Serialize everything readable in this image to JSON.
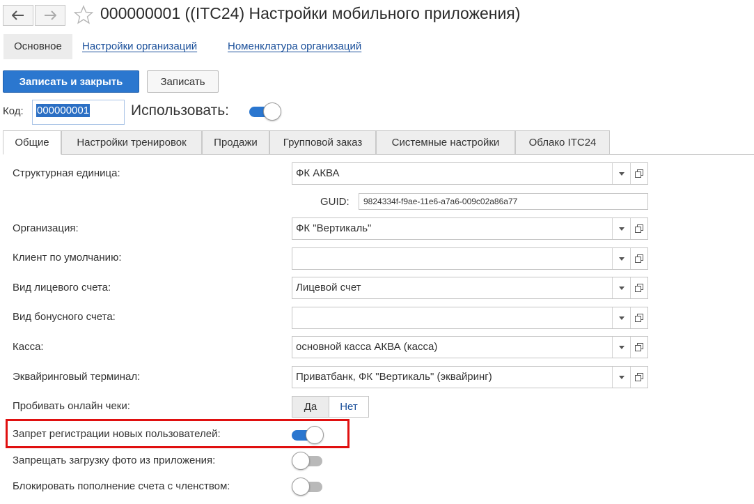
{
  "header": {
    "title": "000000001 ((ITC24) Настройки мобильного приложения)",
    "back_icon": "arrow-left-icon",
    "forward_icon": "arrow-right-icon",
    "favorite_icon": "star-icon"
  },
  "nav_tabs": [
    {
      "label": "Основное",
      "active": true
    },
    {
      "label": "Настройки организаций",
      "active": false
    },
    {
      "label": "Номенклатура организаций",
      "active": false
    }
  ],
  "toolbar": {
    "save_close_label": "Записать и закрыть",
    "save_label": "Записать"
  },
  "code": {
    "label": "Код:",
    "value": "000000001"
  },
  "use": {
    "label": "Использовать:",
    "on": true
  },
  "tabs": [
    {
      "label": "Общие",
      "active": true
    },
    {
      "label": "Настройки тренировок",
      "active": false
    },
    {
      "label": "Продажи",
      "active": false
    },
    {
      "label": "Групповой заказ",
      "active": false
    },
    {
      "label": "Системные настройки",
      "active": false
    },
    {
      "label": "Облако ITC24",
      "active": false
    }
  ],
  "form": {
    "structural_unit": {
      "label": "Структурная единица:",
      "value": "ФК АКВА"
    },
    "guid": {
      "label": "GUID:",
      "value": "9824334f-f9ae-11e6-a7a6-009c02a86a77"
    },
    "organization": {
      "label": "Организация:",
      "value": "ФК \"Вертикаль\""
    },
    "default_client": {
      "label": "Клиент по умолчанию:",
      "value": ""
    },
    "personal_account_type": {
      "label": "Вид лицевого счета:",
      "value": "Лицевой счет"
    },
    "bonus_account_type": {
      "label": "Вид бонусного счета:",
      "value": ""
    },
    "cash_register": {
      "label": "Касса:",
      "value": "основной  касса АКВА (касса)"
    },
    "acquiring_terminal": {
      "label": "Эквайринговый терминал:",
      "value": "Приватбанк, ФК \"Вертикаль\" (эквайринг)"
    },
    "online_receipts": {
      "label": "Пробивать онлайн чеки:",
      "yes": "Да",
      "no": "Нет",
      "selected": "Да"
    },
    "deny_registration": {
      "label": "Запрет регистрации новых пользователей:",
      "on": true
    },
    "deny_photo_upload": {
      "label": "Запрещать загрузку фото из приложения:",
      "on": false
    },
    "block_topup_membership": {
      "label": "Блокировать пополнение счета с членством:",
      "on": false
    }
  },
  "colors": {
    "accent": "#2b77cf",
    "link": "#1a4f9a",
    "highlight_border": "#e01010"
  }
}
